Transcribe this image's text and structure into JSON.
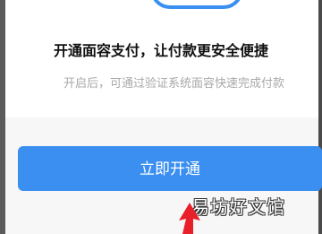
{
  "heading": "开通面容支付，让付款更安全便捷",
  "description": "开启后，可通过验证系统面容快速完成付款",
  "primary_button": "立即开通",
  "watermark": "易坊好文馆",
  "colors": {
    "accent": "#3a8ff0",
    "annotation_arrow": "#e8202a"
  },
  "icons": {
    "illustration": "face-id-illustration",
    "annotation": "red-arrow-annotation"
  }
}
